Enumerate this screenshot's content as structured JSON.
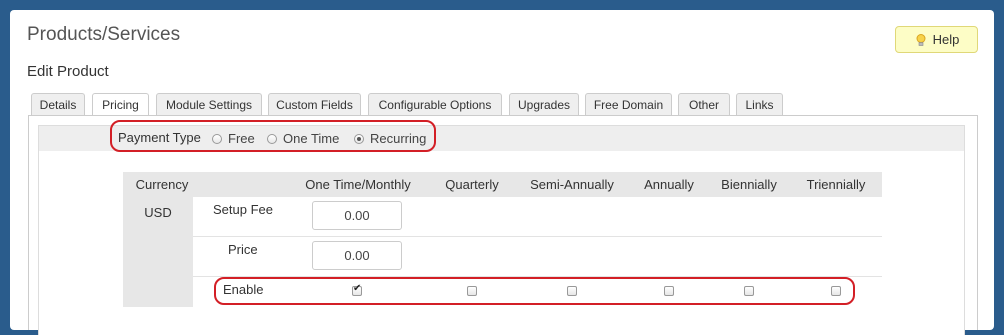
{
  "page": {
    "title": "Products/Services",
    "help_label": "Help",
    "subtitle": "Edit Product"
  },
  "tabs": [
    {
      "label": "Details"
    },
    {
      "label": "Pricing"
    },
    {
      "label": "Module Settings"
    },
    {
      "label": "Custom Fields"
    },
    {
      "label": "Configurable Options"
    },
    {
      "label": "Upgrades"
    },
    {
      "label": "Free Domain"
    },
    {
      "label": "Other"
    },
    {
      "label": "Links"
    }
  ],
  "active_tab": "Pricing",
  "payment_type": {
    "label": "Payment Type",
    "options": [
      {
        "label": "Free",
        "checked": false
      },
      {
        "label": "One Time",
        "checked": false
      },
      {
        "label": "Recurring",
        "checked": true
      }
    ]
  },
  "pricing": {
    "headers": [
      "Currency",
      "One Time/Monthly",
      "Quarterly",
      "Semi-Annually",
      "Annually",
      "Biennially",
      "Triennially"
    ],
    "currency": "USD",
    "setup_fee_label": "Setup Fee",
    "setup_fee_value": "0.00",
    "price_label": "Price",
    "price_value": "0.00",
    "enable_label": "Enable",
    "enable_states": [
      true,
      false,
      false,
      false,
      false,
      false
    ]
  },
  "colors": {
    "background": "#2a5c8c",
    "highlight": "#d31f26",
    "help_bg": "#fdfdc6"
  }
}
